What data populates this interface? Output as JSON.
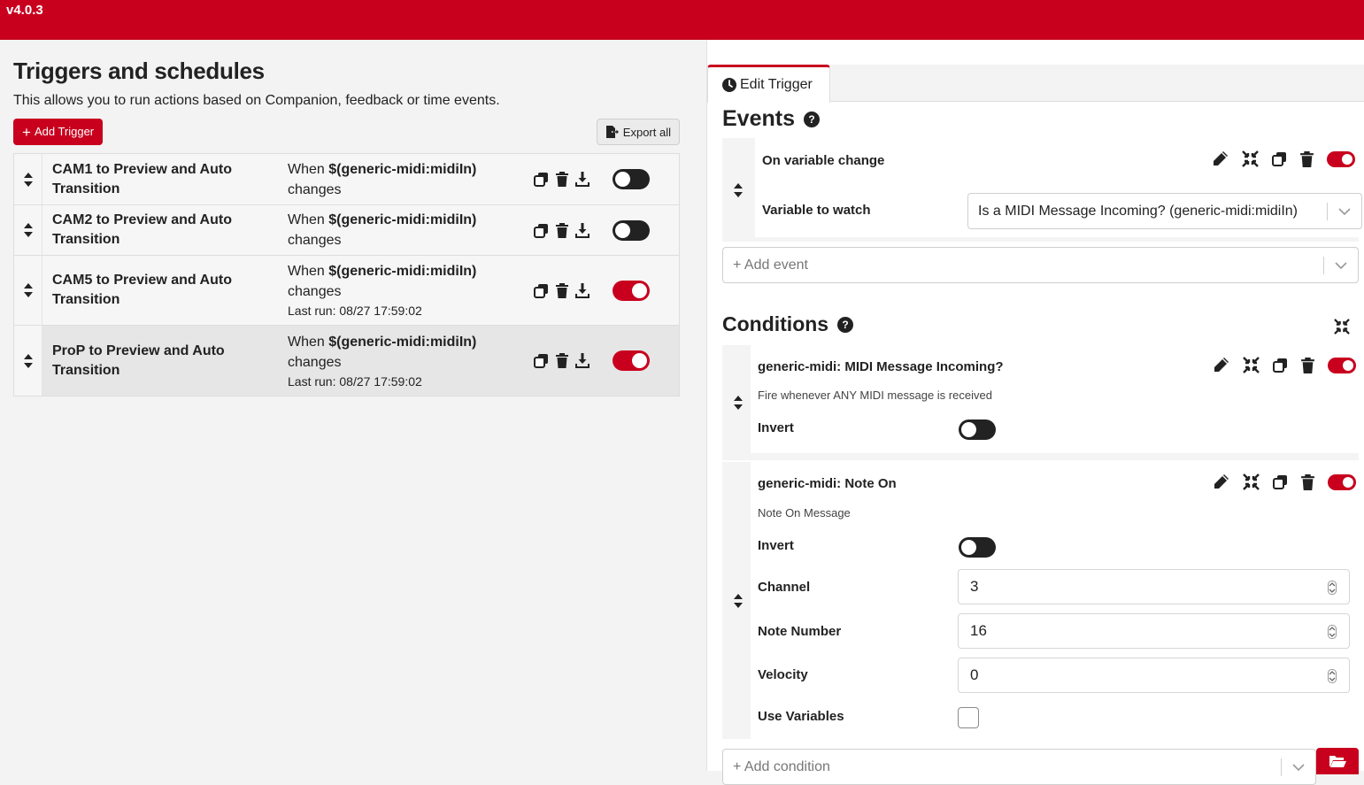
{
  "app": {
    "version": "v4.0.3"
  },
  "left": {
    "title": "Triggers and schedules",
    "description": "This allows you to run actions based on Companion, feedback or time events.",
    "add_trigger_label": "Add Trigger",
    "export_all_label": "Export all",
    "triggers": [
      {
        "name_line1": "CAM1 to Preview and Auto",
        "name_line2": "Transition",
        "when_prefix": "When ",
        "when_var": "$(generic-midi:midiIn)",
        "when_suffix": "changes",
        "last_run": "",
        "enabled": false
      },
      {
        "name_line1": "CAM2 to Preview and Auto",
        "name_line2": "Transition",
        "when_prefix": "When ",
        "when_var": "$(generic-midi:midiIn)",
        "when_suffix": "changes",
        "last_run": "",
        "enabled": false
      },
      {
        "name_line1": "CAM5 to Preview and Auto",
        "name_line2": "Transition",
        "when_prefix": "When ",
        "when_var": "$(generic-midi:midiIn)",
        "when_suffix": "changes",
        "last_run": "Last run: 08/27 17:59:02",
        "enabled": true
      },
      {
        "name_line1": "ProP to Preview and Auto",
        "name_line2": "Transition",
        "when_prefix": "When ",
        "when_var": "$(generic-midi:midiIn)",
        "when_suffix": "changes",
        "last_run": "Last run: 08/27 17:59:02",
        "enabled": true,
        "selected": true
      }
    ]
  },
  "right": {
    "tab_label": "Edit Trigger",
    "events": {
      "title": "Events",
      "help": "?",
      "event_name": "On variable change",
      "variable_label": "Variable to watch",
      "variable_value": "Is a MIDI Message Incoming? (generic-midi:midiIn)",
      "enabled": true,
      "add_event_label": "+ Add event"
    },
    "conditions": {
      "title": "Conditions",
      "help": "?",
      "items": [
        {
          "name": "generic-midi: MIDI Message Incoming?",
          "description": "Fire whenever ANY MIDI message is received",
          "invert_label": "Invert",
          "invert": false,
          "enabled": true
        },
        {
          "name": "generic-midi: Note On",
          "description": "Note On Message",
          "invert_label": "Invert",
          "invert": false,
          "enabled": true,
          "channel_label": "Channel",
          "channel": "3",
          "note_label": "Note Number",
          "note": "16",
          "velocity_label": "Velocity",
          "velocity": "0",
          "use_variables_label": "Use Variables",
          "use_variables": false
        }
      ],
      "add_condition_label": "+ Add condition"
    }
  },
  "colors": {
    "brand": "#c8001e",
    "toggle_off": "#222222"
  },
  "icons": [
    "sort-icon",
    "copy-icon",
    "trash-icon",
    "download-icon",
    "pencil-icon",
    "collapse-icon",
    "clock-icon",
    "export-file-icon",
    "chevron-down-icon",
    "folder-open-icon",
    "spin-icon",
    "help-icon"
  ]
}
